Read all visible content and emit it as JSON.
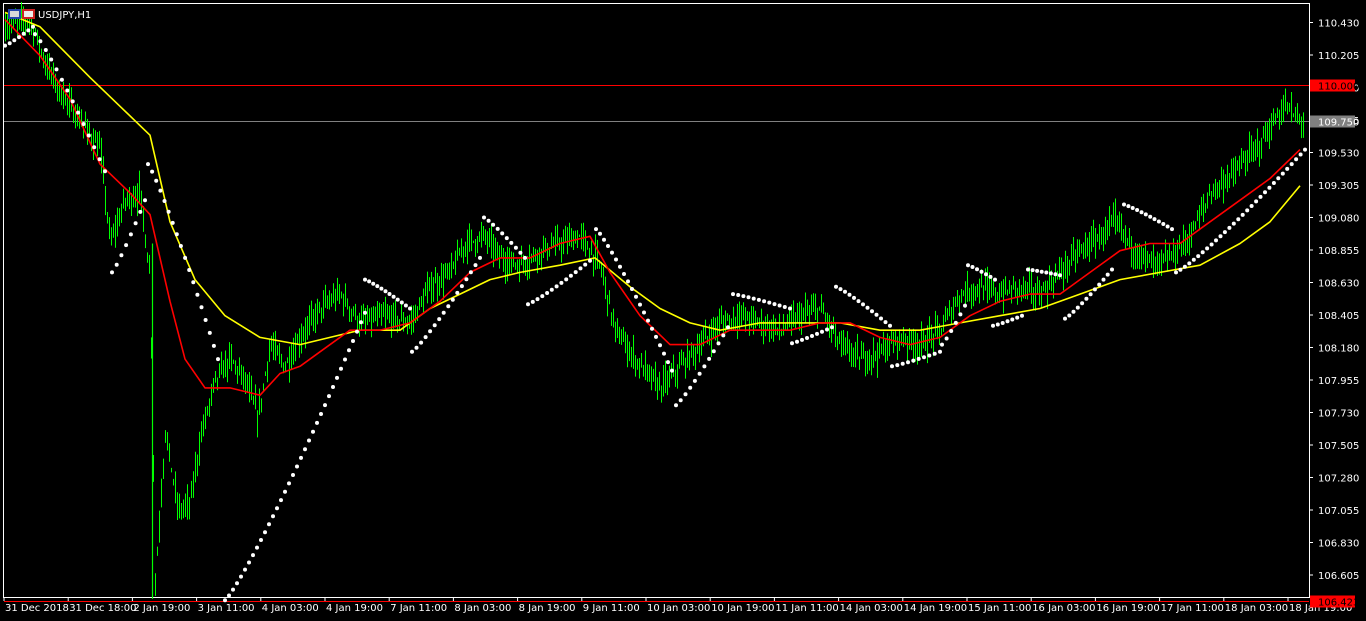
{
  "window": {
    "title": "USDJPY,H1"
  },
  "chart_data": {
    "type": "candlestick",
    "symbol": "USDJPY,H1",
    "colors": {
      "background": "#000000",
      "candles": "#00ff00",
      "ma_fast": "#ff0000",
      "ma_slow": "#ffff00",
      "sar": "#ffffff",
      "hline_upper": "#ff0000",
      "hline_lower": "#ff0000",
      "bid_line": "#808080",
      "grid_frame": "#ffffff"
    },
    "y_ticks": [
      "110.430",
      "110.205",
      "109.980",
      "109.755",
      "109.530",
      "109.305",
      "109.080",
      "108.855",
      "108.630",
      "108.405",
      "108.180",
      "107.955",
      "107.730",
      "107.505",
      "107.280",
      "107.055",
      "106.830",
      "106.605"
    ],
    "ylim": [
      106.38,
      110.53
    ],
    "x_ticks": [
      "31 Dec 2018",
      "31 Dec 18:00",
      "2 Jan 19:00",
      "3 Jan 11:00",
      "4 Jan 03:00",
      "4 Jan 19:00",
      "7 Jan 11:00",
      "8 Jan 03:00",
      "8 Jan 19:00",
      "9 Jan 11:00",
      "10 Jan 03:00",
      "10 Jan 19:00",
      "11 Jan 11:00",
      "14 Jan 03:00",
      "14 Jan 19:00",
      "15 Jan 11:00",
      "16 Jan 03:00",
      "16 Jan 19:00",
      "17 Jan 11:00",
      "18 Jan 03:00",
      "18 Jan 19:00"
    ],
    "hlines": [
      {
        "role": "upper",
        "value": 110.0,
        "label": "110.000"
      },
      {
        "role": "bid",
        "value": 109.75,
        "label": "109.750"
      },
      {
        "role": "lower",
        "value": 106.423,
        "label": "106.423"
      }
    ],
    "price_path": [
      [
        0,
        110.4
      ],
      [
        30,
        110.45
      ],
      [
        45,
        110.15
      ],
      [
        60,
        109.95
      ],
      [
        80,
        109.75
      ],
      [
        100,
        109.55
      ],
      [
        110,
        108.9
      ],
      [
        125,
        109.2
      ],
      [
        140,
        109.25
      ],
      [
        150,
        108.65
      ],
      [
        155,
        106.55
      ],
      [
        165,
        107.6
      ],
      [
        178,
        107.05
      ],
      [
        190,
        107.1
      ],
      [
        200,
        107.55
      ],
      [
        215,
        107.95
      ],
      [
        230,
        108.1
      ],
      [
        245,
        107.95
      ],
      [
        258,
        107.7
      ],
      [
        270,
        108.2
      ],
      [
        285,
        108.05
      ],
      [
        300,
        108.25
      ],
      [
        320,
        108.45
      ],
      [
        340,
        108.55
      ],
      [
        360,
        108.35
      ],
      [
        385,
        108.4
      ],
      [
        410,
        108.35
      ],
      [
        430,
        108.6
      ],
      [
        450,
        108.7
      ],
      [
        465,
        108.9
      ],
      [
        485,
        108.95
      ],
      [
        500,
        108.8
      ],
      [
        520,
        108.75
      ],
      [
        540,
        108.85
      ],
      [
        560,
        108.9
      ],
      [
        580,
        108.95
      ],
      [
        600,
        108.75
      ],
      [
        615,
        108.3
      ],
      [
        635,
        108.1
      ],
      [
        660,
        107.9
      ],
      [
        680,
        108.05
      ],
      [
        700,
        108.2
      ],
      [
        720,
        108.35
      ],
      [
        740,
        108.4
      ],
      [
        760,
        108.35
      ],
      [
        780,
        108.3
      ],
      [
        800,
        108.4
      ],
      [
        820,
        108.45
      ],
      [
        840,
        108.2
      ],
      [
        860,
        108.1
      ],
      [
        880,
        108.15
      ],
      [
        900,
        108.25
      ],
      [
        920,
        108.2
      ],
      [
        940,
        108.3
      ],
      [
        960,
        108.55
      ],
      [
        980,
        108.6
      ],
      [
        1000,
        108.55
      ],
      [
        1020,
        108.6
      ],
      [
        1040,
        108.55
      ],
      [
        1060,
        108.7
      ],
      [
        1080,
        108.85
      ],
      [
        1100,
        108.95
      ],
      [
        1115,
        109.05
      ],
      [
        1135,
        108.85
      ],
      [
        1155,
        108.75
      ],
      [
        1170,
        108.8
      ],
      [
        1190,
        108.95
      ],
      [
        1210,
        109.25
      ],
      [
        1235,
        109.4
      ],
      [
        1255,
        109.55
      ],
      [
        1270,
        109.7
      ],
      [
        1285,
        109.85
      ],
      [
        1300,
        109.75
      ]
    ],
    "ma_fast": [
      [
        5,
        110.45
      ],
      [
        40,
        110.2
      ],
      [
        70,
        109.9
      ],
      [
        100,
        109.45
      ],
      [
        130,
        109.25
      ],
      [
        150,
        109.1
      ],
      [
        170,
        108.5
      ],
      [
        185,
        108.1
      ],
      [
        205,
        107.9
      ],
      [
        230,
        107.9
      ],
      [
        260,
        107.85
      ],
      [
        280,
        108.0
      ],
      [
        300,
        108.05
      ],
      [
        320,
        108.15
      ],
      [
        350,
        108.3
      ],
      [
        380,
        108.3
      ],
      [
        410,
        108.35
      ],
      [
        440,
        108.5
      ],
      [
        470,
        108.7
      ],
      [
        500,
        108.8
      ],
      [
        530,
        108.8
      ],
      [
        560,
        108.9
      ],
      [
        590,
        108.95
      ],
      [
        610,
        108.7
      ],
      [
        640,
        108.4
      ],
      [
        670,
        108.2
      ],
      [
        700,
        108.2
      ],
      [
        730,
        108.3
      ],
      [
        760,
        108.3
      ],
      [
        790,
        108.3
      ],
      [
        820,
        108.35
      ],
      [
        850,
        108.35
      ],
      [
        880,
        108.25
      ],
      [
        910,
        108.2
      ],
      [
        940,
        108.25
      ],
      [
        970,
        108.4
      ],
      [
        1000,
        108.5
      ],
      [
        1030,
        108.55
      ],
      [
        1060,
        108.55
      ],
      [
        1090,
        108.7
      ],
      [
        1120,
        108.85
      ],
      [
        1150,
        108.9
      ],
      [
        1180,
        108.9
      ],
      [
        1210,
        109.05
      ],
      [
        1240,
        109.2
      ],
      [
        1270,
        109.35
      ],
      [
        1300,
        109.55
      ]
    ],
    "ma_slow": [
      [
        5,
        110.5
      ],
      [
        40,
        110.4
      ],
      [
        90,
        110.05
      ],
      [
        120,
        109.85
      ],
      [
        150,
        109.65
      ],
      [
        170,
        109.05
      ],
      [
        195,
        108.65
      ],
      [
        225,
        108.4
      ],
      [
        260,
        108.25
      ],
      [
        300,
        108.2
      ],
      [
        330,
        108.25
      ],
      [
        360,
        108.3
      ],
      [
        400,
        108.3
      ],
      [
        430,
        108.45
      ],
      [
        460,
        108.55
      ],
      [
        490,
        108.65
      ],
      [
        520,
        108.7
      ],
      [
        560,
        108.75
      ],
      [
        595,
        108.8
      ],
      [
        630,
        108.6
      ],
      [
        660,
        108.45
      ],
      [
        690,
        108.35
      ],
      [
        720,
        108.3
      ],
      [
        760,
        108.35
      ],
      [
        800,
        108.35
      ],
      [
        840,
        108.35
      ],
      [
        880,
        108.3
      ],
      [
        920,
        108.3
      ],
      [
        960,
        108.35
      ],
      [
        1000,
        108.4
      ],
      [
        1040,
        108.45
      ],
      [
        1080,
        108.55
      ],
      [
        1120,
        108.65
      ],
      [
        1160,
        108.7
      ],
      [
        1200,
        108.75
      ],
      [
        1240,
        108.9
      ],
      [
        1270,
        109.05
      ],
      [
        1300,
        109.3
      ]
    ],
    "sar_segments": [
      {
        "from": [
          5,
          110.27
        ],
        "to": [
          33,
          110.4
        ],
        "n": 7
      },
      {
        "from": [
          35,
          110.35
        ],
        "to": [
          105,
          109.4
        ],
        "n": 14
      },
      {
        "from": [
          112,
          108.7
        ],
        "to": [
          145,
          109.2
        ],
        "n": 8
      },
      {
        "from": [
          148,
          109.45
        ],
        "to": [
          218,
          108.1
        ],
        "n": 18
      },
      {
        "from": [
          225,
          106.43
        ],
        "to": [
          365,
          108.42
        ],
        "n": 36
      },
      {
        "from": [
          365,
          108.65
        ],
        "to": [
          410,
          108.45
        ],
        "n": 12
      },
      {
        "from": [
          412,
          108.15
        ],
        "to": [
          480,
          108.8
        ],
        "n": 16
      },
      {
        "from": [
          484,
          109.08
        ],
        "to": [
          525,
          108.8
        ],
        "n": 10
      },
      {
        "from": [
          528,
          108.48
        ],
        "to": [
          590,
          108.78
        ],
        "n": 14
      },
      {
        "from": [
          596,
          109.0
        ],
        "to": [
          672,
          108.02
        ],
        "n": 20
      },
      {
        "from": [
          676,
          107.78
        ],
        "to": [
          728,
          108.32
        ],
        "n": 12
      },
      {
        "from": [
          733,
          108.55
        ],
        "to": [
          790,
          108.45
        ],
        "n": 12
      },
      {
        "from": [
          792,
          108.21
        ],
        "to": [
          832,
          108.32
        ],
        "n": 9
      },
      {
        "from": [
          836,
          108.6
        ],
        "to": [
          890,
          108.33
        ],
        "n": 13
      },
      {
        "from": [
          892,
          108.05
        ],
        "to": [
          940,
          108.15
        ],
        "n": 10
      },
      {
        "from": [
          942,
          108.2
        ],
        "to": [
          965,
          108.47
        ],
        "n": 6
      },
      {
        "from": [
          968,
          108.75
        ],
        "to": [
          995,
          108.65
        ],
        "n": 7
      },
      {
        "from": [
          993,
          108.33
        ],
        "to": [
          1022,
          108.4
        ],
        "n": 7
      },
      {
        "from": [
          1028,
          108.72
        ],
        "to": [
          1060,
          108.68
        ],
        "n": 8
      },
      {
        "from": [
          1065,
          108.38
        ],
        "to": [
          1112,
          108.72
        ],
        "n": 12
      },
      {
        "from": [
          1124,
          109.17
        ],
        "to": [
          1172,
          109.0
        ],
        "n": 12
      },
      {
        "from": [
          1176,
          108.7
        ],
        "to": [
          1305,
          109.55
        ],
        "n": 30
      }
    ]
  }
}
